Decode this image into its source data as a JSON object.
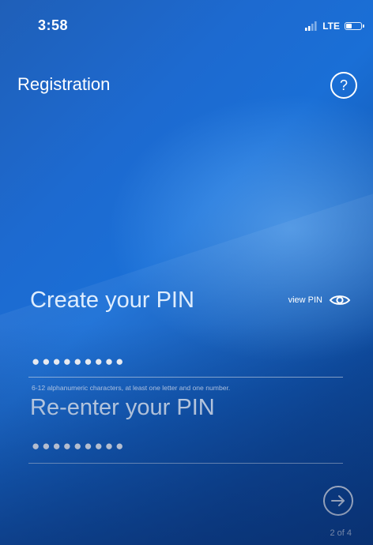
{
  "status_bar": {
    "time": "3:58",
    "network": "LTE",
    "icons": [
      "signal-icon",
      "battery-icon"
    ]
  },
  "header": {
    "title": "Registration",
    "help_label": "?"
  },
  "form": {
    "create_label": "Create your PIN",
    "view_pin_label": "view PIN",
    "create_value": "●●●●●●●●●",
    "hint": "6-12 alphanumeric characters, at least one letter and one number.",
    "reenter_label": "Re-enter your PIN",
    "reenter_value": "●●●●●●●●●"
  },
  "footer": {
    "step": "2 of 4",
    "next_icon": "arrow-right-circle-icon"
  },
  "colors": {
    "background_primary": "#1a6fd6",
    "background_dark": "#0a3e87",
    "text": "#ffffff"
  }
}
